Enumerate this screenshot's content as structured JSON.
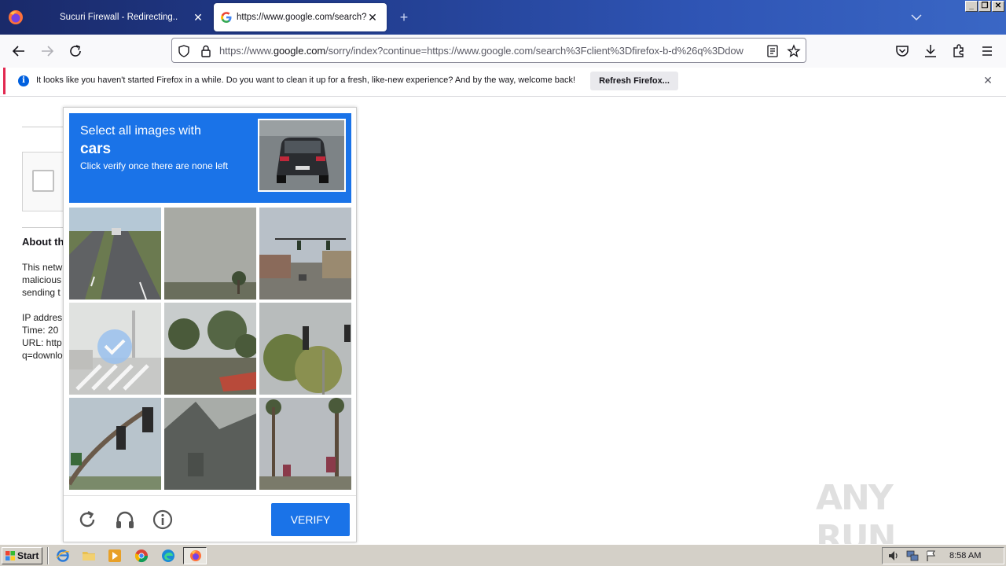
{
  "tabs": [
    {
      "label": "Sucuri Firewall - Redirecting...",
      "close": "✕"
    },
    {
      "label": "https://www.google.com/search?c",
      "close": "✕"
    }
  ],
  "new_tab": "+",
  "window_controls": [
    "_",
    "❐",
    "✕"
  ],
  "url": {
    "prefix": "https://www.",
    "domain": "google.com",
    "rest": "/sorry/index?continue=https://www.google.com/search%3Fclient%3Dfirefox-b-d%26q%3Ddow"
  },
  "notification": {
    "text": "It looks like you haven't started Firefox in a while. Do you want to clean it up for a fresh, like-new experience? And by the way, welcome back!",
    "button": "Refresh Firefox...",
    "close": "✕",
    "info": "i"
  },
  "page": {
    "about": "About th",
    "lines": [
      "This netw",
      "malicious",
      "sending t",
      "",
      "IP addres",
      "Time: 20",
      "URL: http",
      "q=downlo"
    ]
  },
  "captcha": {
    "instruction": "Select all images with",
    "target": "cars",
    "sub": "Click verify once there are none left",
    "verify": "VERIFY",
    "selected_tiles": [
      3
    ]
  },
  "watermark": "ANY RUN",
  "taskbar": {
    "start": "Start",
    "clock": "8:58 AM"
  },
  "colors": {
    "accent": "#1a73e8",
    "notif_border": "#e22850"
  }
}
